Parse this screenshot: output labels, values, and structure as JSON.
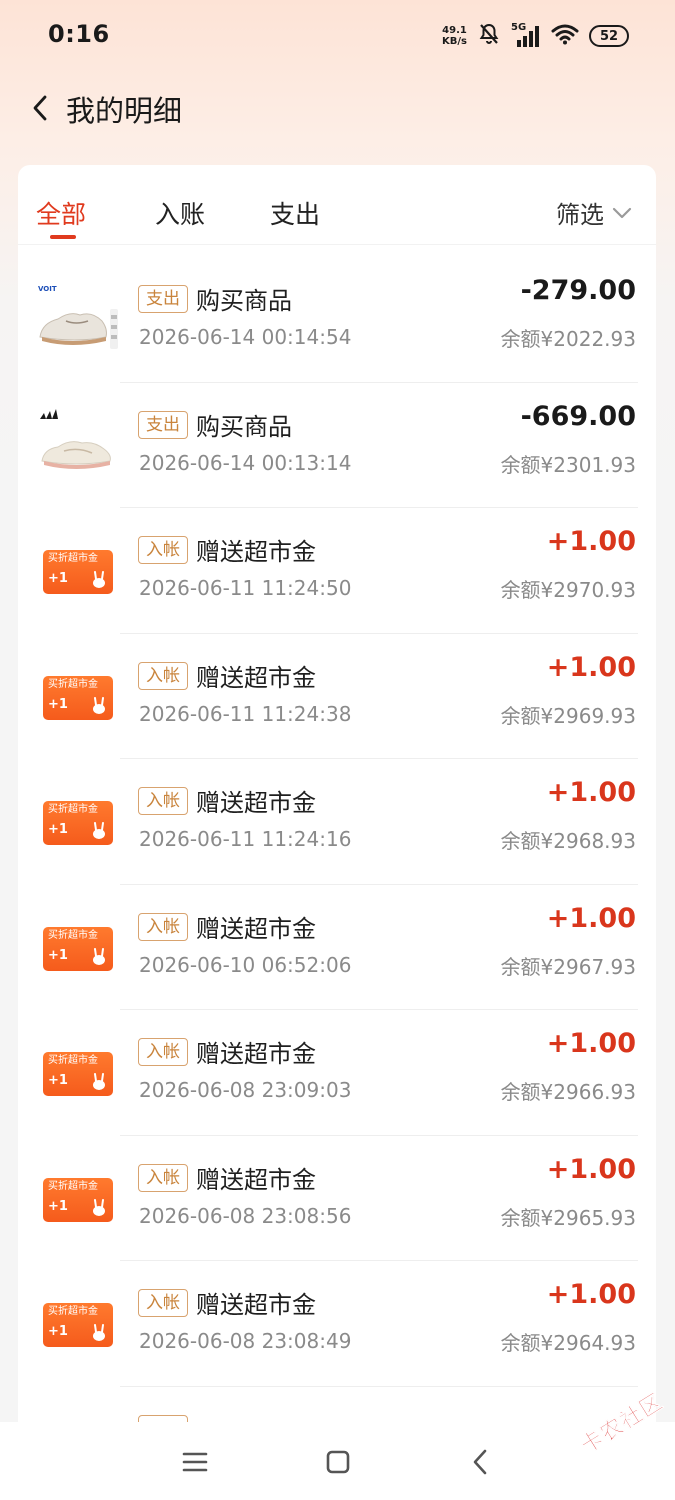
{
  "status_bar": {
    "time": "0:16",
    "net_speed_value": "49.1",
    "net_speed_unit": "KB/s",
    "network_type": "5G",
    "battery": "52"
  },
  "header": {
    "title": "我的明细"
  },
  "tabs": {
    "all": "全部",
    "income": "入账",
    "expense": "支出",
    "filter": "筛选",
    "active": "all"
  },
  "coupon_badge": {
    "title": "买折超市金",
    "plus": "+1"
  },
  "transactions": [
    {
      "icon": "shoe-thumbnail-icon",
      "tag": "支出",
      "title": "购买商品",
      "time": "2026-06-14 00:14:54",
      "amount": "-279.00",
      "balance": "余额¥2022.93",
      "type": "expense"
    },
    {
      "icon": "shoe-thumbnail-icon",
      "tag": "支出",
      "title": "购买商品",
      "time": "2026-06-14 00:13:14",
      "amount": "-669.00",
      "balance": "余额¥2301.93",
      "type": "expense"
    },
    {
      "icon": "supermarket-coupon-icon",
      "tag": "入帐",
      "title": "赠送超市金",
      "time": "2026-06-11 11:24:50",
      "amount": "+1.00",
      "balance": "余额¥2970.93",
      "type": "income"
    },
    {
      "icon": "supermarket-coupon-icon",
      "tag": "入帐",
      "title": "赠送超市金",
      "time": "2026-06-11 11:24:38",
      "amount": "+1.00",
      "balance": "余额¥2969.93",
      "type": "income"
    },
    {
      "icon": "supermarket-coupon-icon",
      "tag": "入帐",
      "title": "赠送超市金",
      "time": "2026-06-11 11:24:16",
      "amount": "+1.00",
      "balance": "余额¥2968.93",
      "type": "income"
    },
    {
      "icon": "supermarket-coupon-icon",
      "tag": "入帐",
      "title": "赠送超市金",
      "time": "2026-06-10 06:52:06",
      "amount": "+1.00",
      "balance": "余额¥2967.93",
      "type": "income"
    },
    {
      "icon": "supermarket-coupon-icon",
      "tag": "入帐",
      "title": "赠送超市金",
      "time": "2026-06-08 23:09:03",
      "amount": "+1.00",
      "balance": "余额¥2966.93",
      "type": "income"
    },
    {
      "icon": "supermarket-coupon-icon",
      "tag": "入帐",
      "title": "赠送超市金",
      "time": "2026-06-08 23:08:56",
      "amount": "+1.00",
      "balance": "余额¥2965.93",
      "type": "income"
    },
    {
      "icon": "supermarket-coupon-icon",
      "tag": "入帐",
      "title": "赠送超市金",
      "time": "2026-06-08 23:08:49",
      "amount": "+1.00",
      "balance": "余额¥2964.93",
      "type": "income"
    }
  ],
  "colors": {
    "accent": "#e03a1e",
    "income": "#d9361c",
    "tag_border": "#d8a36f",
    "coupon": "#f55b1c"
  },
  "watermark": "卡农社区",
  "nav_bar": {
    "buttons": [
      "menu-icon",
      "home-square-icon",
      "back-triangle-icon"
    ]
  }
}
